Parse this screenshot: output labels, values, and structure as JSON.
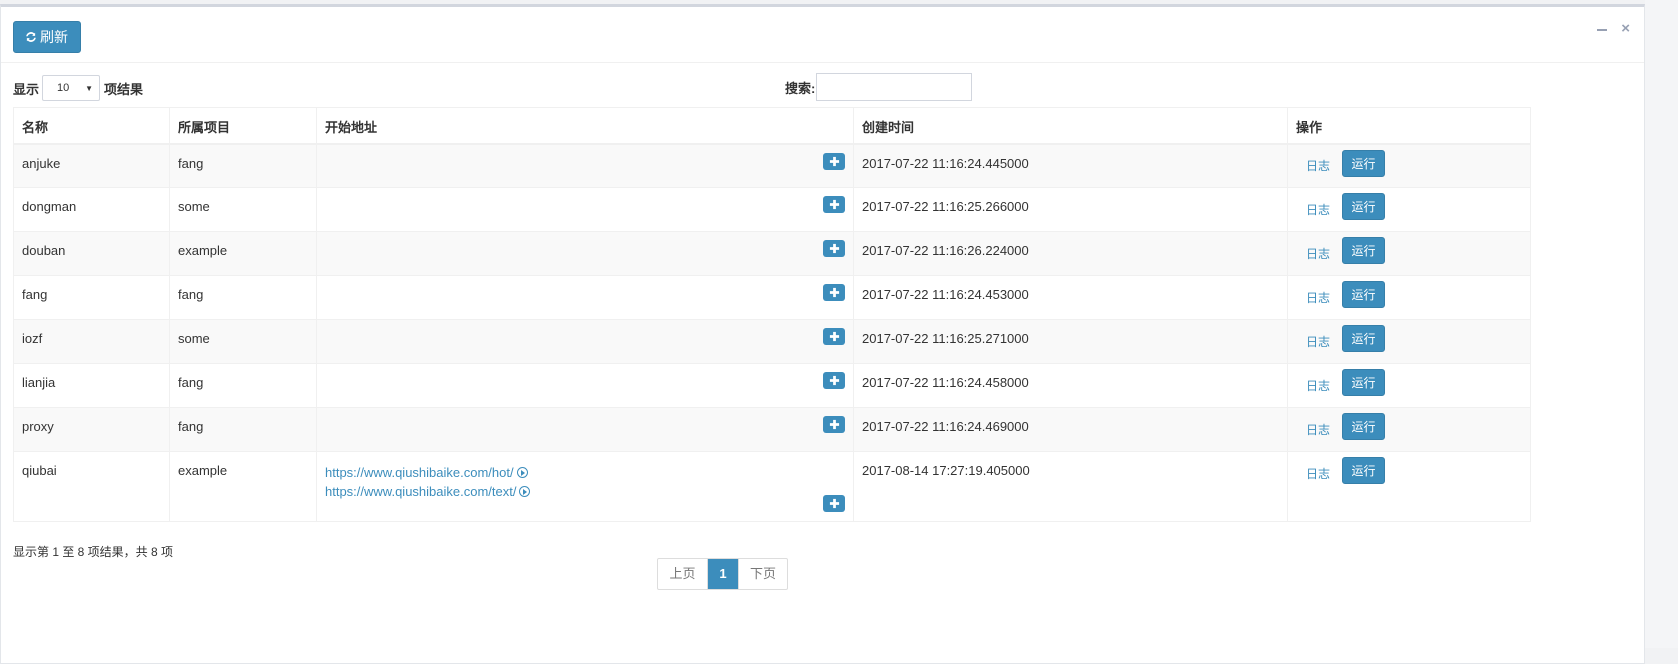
{
  "toolbar": {
    "refresh_label": "刷新"
  },
  "length": {
    "prefix": "显示",
    "value": "10",
    "suffix": "项结果"
  },
  "search": {
    "label": "搜索:",
    "value": ""
  },
  "columns": [
    "名称",
    "所属项目",
    "开始地址",
    "创建时间",
    "操作"
  ],
  "rows": [
    {
      "name": "anjuke",
      "project": "fang",
      "urls": [],
      "created": "2017-07-22 11:16:24.445000",
      "log": "日志",
      "run": "运行"
    },
    {
      "name": "dongman",
      "project": "some",
      "urls": [],
      "created": "2017-07-22 11:16:25.266000",
      "log": "日志",
      "run": "运行"
    },
    {
      "name": "douban",
      "project": "example",
      "urls": [],
      "created": "2017-07-22 11:16:26.224000",
      "log": "日志",
      "run": "运行"
    },
    {
      "name": "fang",
      "project": "fang",
      "urls": [],
      "created": "2017-07-22 11:16:24.453000",
      "log": "日志",
      "run": "运行"
    },
    {
      "name": "iozf",
      "project": "some",
      "urls": [],
      "created": "2017-07-22 11:16:25.271000",
      "log": "日志",
      "run": "运行"
    },
    {
      "name": "lianjia",
      "project": "fang",
      "urls": [],
      "created": "2017-07-22 11:16:24.458000",
      "log": "日志",
      "run": "运行"
    },
    {
      "name": "proxy",
      "project": "fang",
      "urls": [],
      "created": "2017-07-22 11:16:24.469000",
      "log": "日志",
      "run": "运行"
    },
    {
      "name": "qiubai",
      "project": "example",
      "urls": [
        "https://www.qiushibaike.com/hot/",
        "https://www.qiushibaike.com/text/"
      ],
      "created": "2017-08-14 17:27:19.405000",
      "log": "日志",
      "run": "运行"
    }
  ],
  "footer": {
    "info": "显示第 1 至 8 项结果，共 8 项"
  },
  "pagination": {
    "prev": "上页",
    "current": "1",
    "next": "下页"
  },
  "colors": {
    "primary": "#3c8dbc",
    "stripe": "#f9f9f9"
  }
}
